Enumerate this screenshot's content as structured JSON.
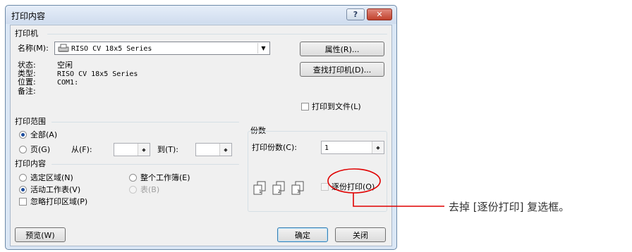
{
  "window": {
    "title": "打印内容",
    "help_label": "?",
    "close_label": "✕"
  },
  "printer": {
    "group_label": "打印机",
    "name_label": "名称(M):",
    "name_value": "RISO CV 18x5 Series",
    "properties_button": "属性(R)...",
    "find_button": "查找打印机(D)...",
    "status_label": "状态:",
    "status_value": "空闲",
    "type_label": "类型:",
    "type_value": "RISO CV 18x5 Series",
    "where_label": "位置:",
    "where_value": "COM1:",
    "comment_label": "备注:",
    "print_to_file": "打印到文件(L)"
  },
  "range": {
    "group_label": "打印范围",
    "all_label": "全部(A)",
    "pages_label": "页(G)",
    "from_label": "从(F):",
    "to_label": "到(T):"
  },
  "what": {
    "group_label": "打印内容",
    "selection_label": "选定区域(N)",
    "entire_workbook_label": "整个工作簿(E)",
    "active_sheets_label": "活动工作表(V)",
    "table_label": "表(B)",
    "ignore_areas_label": "忽略打印区域(P)"
  },
  "copies": {
    "group_label": "份数",
    "number_label": "打印份数(C):",
    "number_value": "1",
    "collate_label": "逐份打印(O)"
  },
  "footer": {
    "preview_button": "预览(W)",
    "ok_button": "确定",
    "cancel_button": "关闭"
  },
  "annotation": {
    "text": "去掉 [逐份打印] 复选框。",
    "color": "#e00000"
  }
}
